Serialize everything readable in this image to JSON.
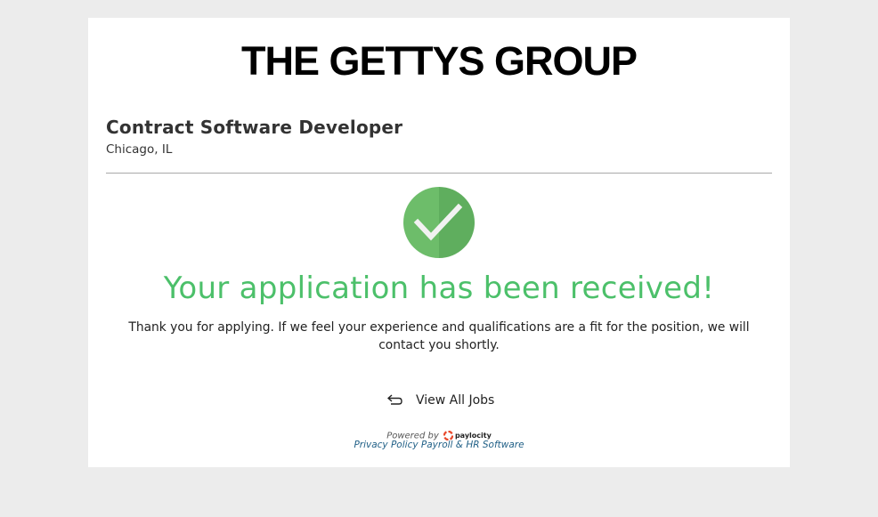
{
  "company": {
    "logo_text": "THE GETTYS GROUP"
  },
  "job": {
    "title": "Contract Software Developer",
    "location": "Chicago, IL"
  },
  "confirmation": {
    "headline": "Your application has been received!",
    "message": "Thank you for applying. If we feel your experience and qualifications are a fit for the position, we will contact you shortly."
  },
  "actions": {
    "view_all_jobs": "View All Jobs"
  },
  "footer": {
    "powered_by": "Powered by",
    "vendor_name": "paylocity",
    "privacy_policy": "Privacy Policy",
    "payroll_link": "Payroll & HR Software"
  },
  "colors": {
    "success_green": "#4cc06a",
    "check_light": "#6dbd6a",
    "check_dark": "#5fae5e",
    "link_blue": "#1f5f86",
    "page_background": "#ececec"
  }
}
